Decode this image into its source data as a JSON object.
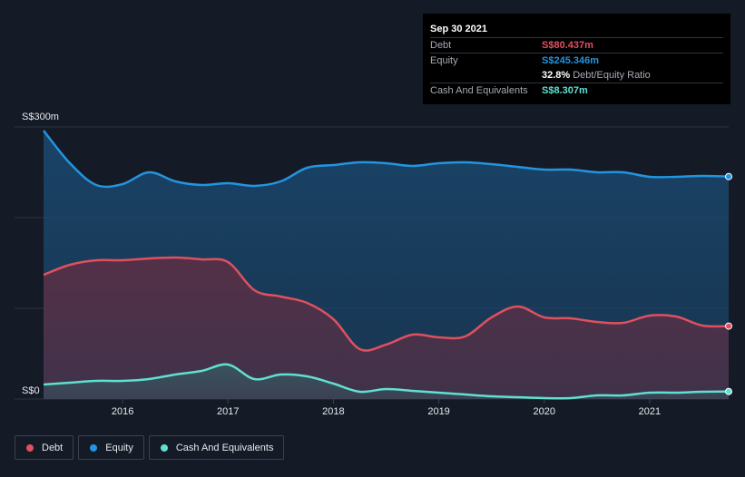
{
  "colors": {
    "debt": "#e0505f",
    "equity": "#2394df",
    "cash": "#5fe0d0",
    "background": "#151b26"
  },
  "tooltip": {
    "date": "Sep 30 2021",
    "debt_label": "Debt",
    "debt_value": "S$80.437m",
    "equity_label": "Equity",
    "equity_value": "S$245.346m",
    "ratio_value": "32.8%",
    "ratio_label": "Debt/Equity Ratio",
    "cash_label": "Cash And Equivalents",
    "cash_value": "S$8.307m"
  },
  "legend": [
    {
      "label": "Debt",
      "color": "#e0505f"
    },
    {
      "label": "Equity",
      "color": "#2394df"
    },
    {
      "label": "Cash And Equivalents",
      "color": "#5fe0d0"
    }
  ],
  "chart_data": {
    "type": "area",
    "y_unit_prefix": "S$",
    "ylim": [
      0,
      300
    ],
    "xlim": [
      2015.25,
      2021.75
    ],
    "y_tick_labels": [
      {
        "value": 300,
        "label": "S$300m"
      },
      {
        "value": 0,
        "label": "S$0"
      }
    ],
    "x_tick_labels": [
      {
        "value": 2016,
        "label": "2016"
      },
      {
        "value": 2017,
        "label": "2017"
      },
      {
        "value": 2018,
        "label": "2018"
      },
      {
        "value": 2019,
        "label": "2019"
      },
      {
        "value": 2020,
        "label": "2020"
      },
      {
        "value": 2021,
        "label": "2021"
      }
    ],
    "grid": true,
    "legend_position": "bottom-left",
    "series": [
      {
        "name": "Equity",
        "key": "equity",
        "points": [
          [
            2015.25,
            296
          ],
          [
            2015.5,
            260
          ],
          [
            2015.75,
            236
          ],
          [
            2016.0,
            237
          ],
          [
            2016.25,
            250
          ],
          [
            2016.5,
            240
          ],
          [
            2016.75,
            236
          ],
          [
            2017.0,
            238
          ],
          [
            2017.25,
            235
          ],
          [
            2017.5,
            240
          ],
          [
            2017.75,
            255
          ],
          [
            2018.0,
            258
          ],
          [
            2018.25,
            261
          ],
          [
            2018.5,
            260
          ],
          [
            2018.75,
            257
          ],
          [
            2019.0,
            260
          ],
          [
            2019.25,
            261
          ],
          [
            2019.5,
            259
          ],
          [
            2019.75,
            256
          ],
          [
            2020.0,
            253
          ],
          [
            2020.25,
            253
          ],
          [
            2020.5,
            250
          ],
          [
            2020.75,
            250
          ],
          [
            2021.0,
            245
          ],
          [
            2021.25,
            245
          ],
          [
            2021.5,
            246
          ],
          [
            2021.75,
            245.3
          ]
        ]
      },
      {
        "name": "Debt",
        "key": "debt",
        "points": [
          [
            2015.25,
            137
          ],
          [
            2015.5,
            148
          ],
          [
            2015.75,
            153
          ],
          [
            2016.0,
            153
          ],
          [
            2016.25,
            155
          ],
          [
            2016.5,
            156
          ],
          [
            2016.75,
            154
          ],
          [
            2017.0,
            151
          ],
          [
            2017.25,
            120
          ],
          [
            2017.5,
            113
          ],
          [
            2017.75,
            106
          ],
          [
            2018.0,
            88
          ],
          [
            2018.25,
            55
          ],
          [
            2018.5,
            60
          ],
          [
            2018.75,
            71
          ],
          [
            2019.0,
            68
          ],
          [
            2019.25,
            69
          ],
          [
            2019.5,
            90
          ],
          [
            2019.75,
            102
          ],
          [
            2020.0,
            90
          ],
          [
            2020.25,
            89
          ],
          [
            2020.5,
            85
          ],
          [
            2020.75,
            84
          ],
          [
            2021.0,
            92
          ],
          [
            2021.25,
            91
          ],
          [
            2021.5,
            81
          ],
          [
            2021.75,
            80.4
          ]
        ]
      },
      {
        "name": "Cash And Equivalents",
        "key": "cash",
        "points": [
          [
            2015.25,
            16
          ],
          [
            2015.5,
            18
          ],
          [
            2015.75,
            20
          ],
          [
            2016.0,
            20
          ],
          [
            2016.25,
            22
          ],
          [
            2016.5,
            27
          ],
          [
            2016.75,
            31
          ],
          [
            2017.0,
            38
          ],
          [
            2017.25,
            22
          ],
          [
            2017.5,
            27
          ],
          [
            2017.75,
            25
          ],
          [
            2018.0,
            17
          ],
          [
            2018.25,
            8
          ],
          [
            2018.5,
            11
          ],
          [
            2018.75,
            9
          ],
          [
            2019.0,
            7
          ],
          [
            2019.25,
            5
          ],
          [
            2019.5,
            3
          ],
          [
            2019.75,
            2
          ],
          [
            2020.0,
            1
          ],
          [
            2020.25,
            1
          ],
          [
            2020.5,
            4
          ],
          [
            2020.75,
            4
          ],
          [
            2021.0,
            7
          ],
          [
            2021.25,
            7
          ],
          [
            2021.5,
            8
          ],
          [
            2021.75,
            8.3
          ]
        ]
      }
    ]
  }
}
